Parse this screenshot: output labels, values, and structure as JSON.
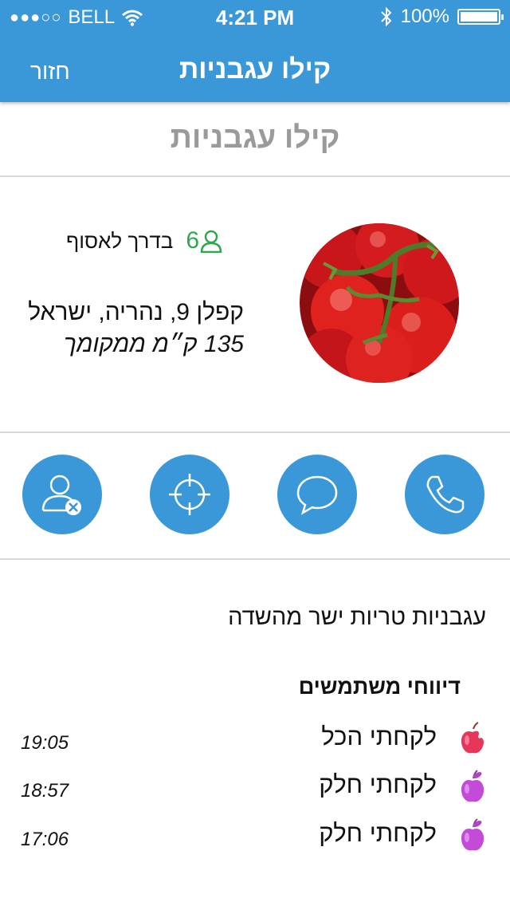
{
  "status_bar": {
    "signal_dots": "●●●○○",
    "carrier": "BELL",
    "time": "4:21 PM",
    "battery": "100%"
  },
  "nav": {
    "title": "קילו עגבניות",
    "back_label": "חזור"
  },
  "product": {
    "title": "קילו עגבניות",
    "collectors_count": "6",
    "collectors_label": "בדרך לאסוף",
    "address": "קפלן 9, נהריה, ישראל",
    "distance": "135 ק״מ ממקומך",
    "description": "עגבניות טריות ישר מהשדה"
  },
  "actions": [
    {
      "icon": "remove-user-icon"
    },
    {
      "icon": "target-icon"
    },
    {
      "icon": "chat-icon"
    },
    {
      "icon": "phone-icon"
    }
  ],
  "reports": {
    "title": "דיווחי משתמשים",
    "items": [
      {
        "text": "לקחתי הכל",
        "time": "19:05",
        "icon": "apple-bitten-icon",
        "color": "#e8355a"
      },
      {
        "text": "לקחתי חלק",
        "time": "18:57",
        "icon": "apple-icon",
        "color": "#c44bd8"
      },
      {
        "text": "לקחתי חלק",
        "time": "17:06",
        "icon": "apple-icon",
        "color": "#c44bd8"
      }
    ]
  },
  "colors": {
    "primary": "#3a97d8",
    "collectors_green": "#2ea84a",
    "title_gray": "#9a9a9a"
  }
}
